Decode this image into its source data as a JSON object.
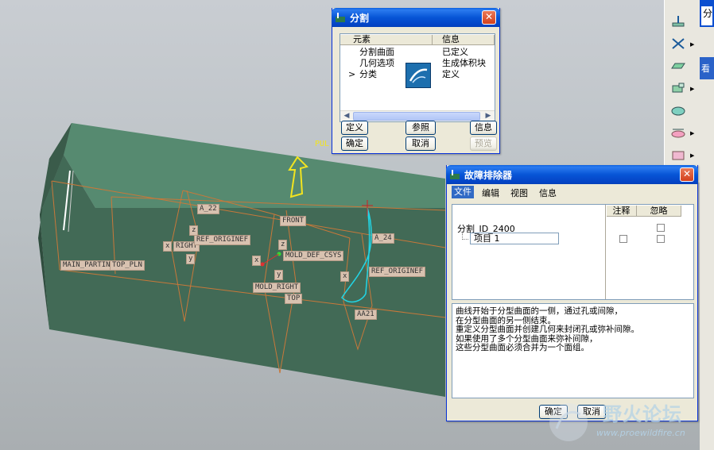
{
  "model_labels": {
    "pull_direction": "PUL",
    "a22": "A_22",
    "a24": "A_24",
    "main_parting": "MAIN_PARTING",
    "top_pln": "TOP_PLN",
    "right": "RIGHT",
    "ref_origin_left": "REF_ORIGINEF",
    "ref_origin_right": "REF_ORIGINEF",
    "front": "FRONT",
    "mold_def_csys": "MOLD_DEF_CSYS",
    "mold_right": "MOLD_RIGHT",
    "top": "TOP",
    "aa21": "AA21",
    "x1": "x",
    "x2": "x",
    "x3": "x",
    "z1": "z",
    "z2": "z",
    "y1": "y",
    "y2": "y"
  },
  "split_dialog": {
    "title": "分割",
    "col_element": "元素",
    "col_info": "信息",
    "rows": [
      {
        "name": "分割曲面",
        "info": "已定义"
      },
      {
        "name": "几何选项",
        "info": "生成体积块"
      },
      {
        "name": "分类",
        "info": "定义",
        "marker": ">"
      }
    ],
    "btn_define": "定义",
    "btn_reference": "参照",
    "btn_info": "信息",
    "btn_ok": "确定",
    "btn_cancel": "取消",
    "btn_preview": "预览"
  },
  "troubleshooter": {
    "title": "故障排除器",
    "menu": [
      "文件",
      "编辑",
      "视图",
      "信息"
    ],
    "col_note": "注释",
    "col_ignore": "忽略",
    "tree_root": "分割_ID_2400",
    "tree_child": "项目 1",
    "message": [
      "曲线开始于分型曲面的一侧，通过孔或间隙，",
      "在分型曲面的另一侧结束。",
      "重定义分型曲面并创建几何来封闭孔或弥补间隙。",
      "如果使用了多个分型曲面来弥补间隙，",
      "这些分型曲面必须合并为一个面组。"
    ],
    "btn_ok": "确定",
    "btn_cancel": "取消"
  },
  "edge_panel": {
    "text1": "分",
    "text2": "看"
  },
  "watermark": {
    "cn": "野火论坛",
    "url": "www.proewildfire.cn"
  },
  "colors": {
    "body": "#4e7c63",
    "titlebar": "#0755d6",
    "accent_cyan": "#22d6e6",
    "datum_orange": "#c8783a"
  }
}
